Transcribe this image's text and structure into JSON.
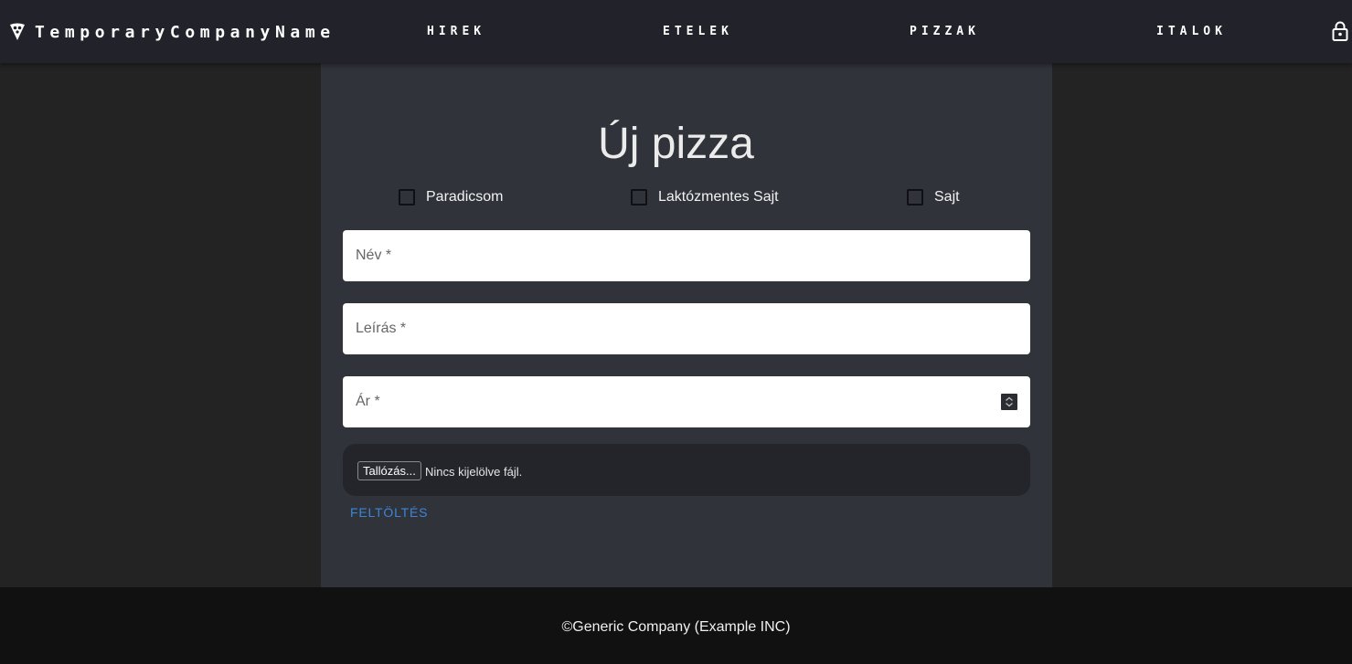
{
  "navbar": {
    "brand_name": "TemporaryCompanyName",
    "brand_icon": "pizza-slice-icon",
    "links": [
      "HIREK",
      "ETELEK",
      "PIZZAK",
      "ITALOK"
    ],
    "lock_icon": "lock-icon"
  },
  "form": {
    "title": "Új pizza",
    "toppings": [
      {
        "label": "Paradicsom",
        "checked": false
      },
      {
        "label": "Laktózmentes Sajt",
        "checked": false
      },
      {
        "label": "Sajt",
        "checked": false
      }
    ],
    "fields": {
      "name_label": "Név *",
      "description_label": "Leírás *",
      "price_label": "Ár *"
    },
    "file": {
      "browse_label": "Tallózás...",
      "status": "Nincs kijelölve fájl."
    },
    "upload_label": "FELTÖLTÉS"
  },
  "footer": {
    "text": "©Generic Company (Example INC)"
  },
  "colors": {
    "navbar_bg": "#21222a",
    "page_bg": "#232323",
    "panel_bg": "#31333b",
    "footer_bg": "#111111",
    "accent": "#3c85d6"
  }
}
